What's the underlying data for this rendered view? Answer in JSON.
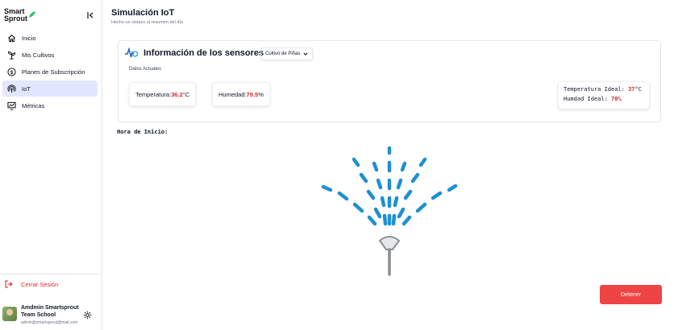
{
  "brand": {
    "line1": "Smart",
    "line2": "Sprout"
  },
  "sidebar": {
    "items": [
      {
        "label": "Inicio",
        "icon": "home-icon"
      },
      {
        "label": "Mis Cultivos",
        "icon": "plant-icon"
      },
      {
        "label": "Planes de Subscripción",
        "icon": "dollar-icon"
      },
      {
        "label": "IoT",
        "icon": "broadcast-icon",
        "active": true
      },
      {
        "label": "Métricas",
        "icon": "chart-icon"
      }
    ],
    "logout_label": "Cerrar Sesión",
    "user": {
      "name": "Amdmin Smartsprout Team School",
      "email": "admin@smartsprout@mail.com"
    }
  },
  "header": {
    "title": "Simulación IoT",
    "subtitle": "Hecho un vistazo al resumen del día"
  },
  "sensors": {
    "title": "Información de los sensores",
    "crop_selected": "Cultivo de Piñas",
    "current_label": "Datos Actuales",
    "temperature": {
      "label": "Temperatura: ",
      "value": "36.2",
      "unit": "°C"
    },
    "humidity": {
      "label": "Humedad: ",
      "value": "79.5",
      "unit": "%"
    },
    "ideal": {
      "temp_label": "Temperatura Ideal: ",
      "temp_value": "37",
      "temp_unit": "°C",
      "hum_label": "Humdad Ideal: ",
      "hum_value": "70%"
    }
  },
  "start_label": "Hora de Inicio:",
  "stop_label": "Detener",
  "colors": {
    "accent": "#e0e7ff",
    "danger": "#ef4444",
    "water": "#1e90d0",
    "value_red": "#dc2626"
  }
}
